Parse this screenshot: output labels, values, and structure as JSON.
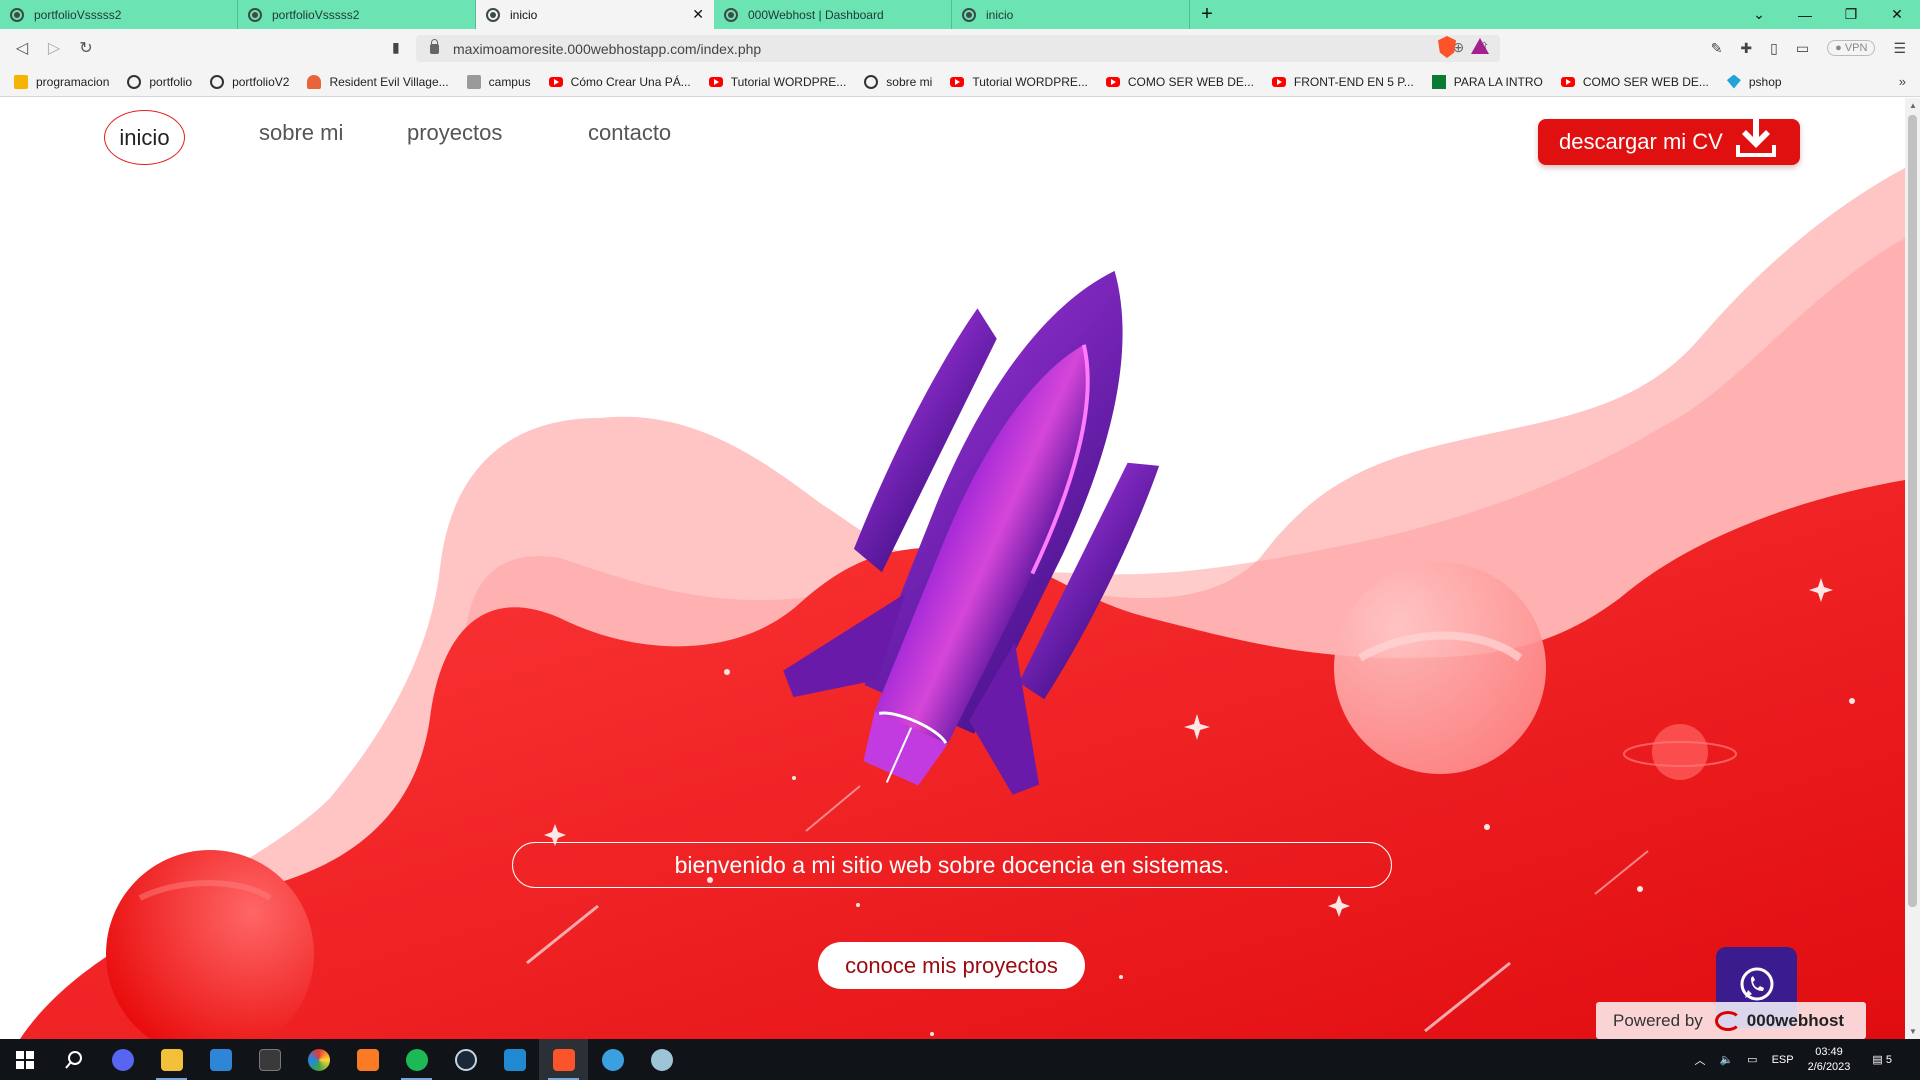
{
  "browser": {
    "tabs": [
      {
        "title": "portfolioVsssss2",
        "active": false
      },
      {
        "title": "portfolioVsssss2",
        "active": false
      },
      {
        "title": "inicio",
        "active": true
      },
      {
        "title": "000Webhost | Dashboard",
        "active": false
      },
      {
        "title": "inicio",
        "active": false
      }
    ],
    "url": "maximoamoresite.000webhostapp.com/index.php",
    "vpn_label": "VPN",
    "bookmarks": [
      {
        "label": "programacion",
        "icon": "folder-icon"
      },
      {
        "label": "portfolio",
        "icon": "globe-icon"
      },
      {
        "label": "portfolioV2",
        "icon": "globe-icon"
      },
      {
        "label": "Resident Evil Village...",
        "icon": "game-icon"
      },
      {
        "label": "campus",
        "icon": "campus-icon"
      },
      {
        "label": "Cómo Crear Una PÁ...",
        "icon": "youtube-icon"
      },
      {
        "label": "Tutorial WORDPRE...",
        "icon": "youtube-icon"
      },
      {
        "label": "sobre mi",
        "icon": "globe-icon"
      },
      {
        "label": "Tutorial WORDPRE...",
        "icon": "youtube-icon"
      },
      {
        "label": "COMO SER WEB DE...",
        "icon": "youtube-icon"
      },
      {
        "label": "FRONT-END EN 5 P...",
        "icon": "youtube-icon"
      },
      {
        "label": "PARA LA INTRO",
        "icon": "green-icon"
      },
      {
        "label": "COMO SER WEB DE...",
        "icon": "youtube-icon"
      },
      {
        "label": "pshop",
        "icon": "pshop-icon"
      }
    ]
  },
  "site": {
    "nav": {
      "inicio": "inicio",
      "sobre_mi": "sobre mi",
      "proyectos": "proyectos",
      "contacto": "contacto"
    },
    "cv_button": "descargar mi CV",
    "welcome_text": "bienvenido a mi sitio web sobre docencia en sistemas.",
    "projects_button": "conoce mis proyectos",
    "powered_by": "Powered by",
    "powered_brand": "000webhost",
    "colors": {
      "accent_red": "#e01010",
      "wave_pink": "#ffc0c0",
      "rocket_purple": "#7a1fb3",
      "whatsapp_bg": "#3b1c8f"
    }
  },
  "taskbar": {
    "apps": [
      "windows-start-icon",
      "search-icon",
      "discord-icon",
      "file-explorer-icon",
      "store-icon",
      "bm-icon",
      "color-app-icon",
      "xampp-icon",
      "spotify-icon",
      "steam-icon",
      "vscode-icon",
      "brave-icon",
      "browser-app-icon",
      "paint-app-icon"
    ],
    "language": "ESP",
    "time": "03:49",
    "date": "2/6/2023",
    "notifications": "5"
  }
}
